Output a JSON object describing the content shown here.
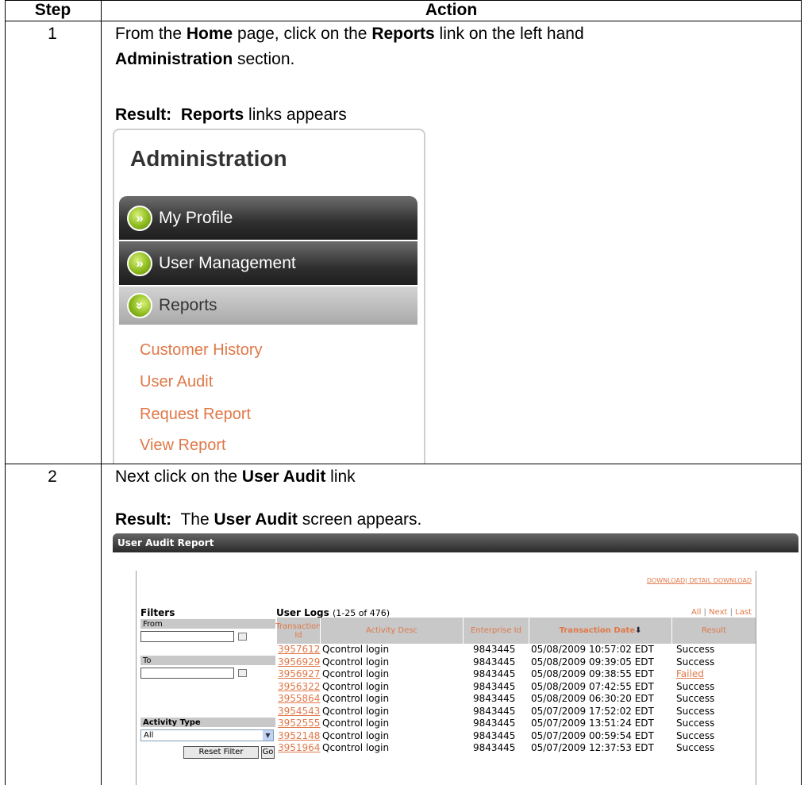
{
  "table": {
    "col_step": "Step",
    "col_action": "Action"
  },
  "steps": [
    {
      "number": "1",
      "line1_pre": "From the ",
      "line1_b1": "Home",
      "line1_mid": " page, click on the ",
      "line1_b2": "Reports",
      "line1_post": " link on the left hand",
      "line2_b": "Administration",
      "line2_post": " section.",
      "result_label": "Result:",
      "result_b": "Reports",
      "result_post": " links appears"
    },
    {
      "number": "2",
      "line1_pre": "Next click on the ",
      "line1_b": "User Audit",
      "line1_post": " link",
      "result_label": "Result:",
      "result_pre": "  The ",
      "result_b": "User Audit",
      "result_post": " screen appears."
    }
  ],
  "admin_panel": {
    "title": "Administration",
    "menu": [
      {
        "label": "My Profile",
        "icon": "double-chevron-right-icon"
      },
      {
        "label": "User Management",
        "icon": "double-chevron-right-icon"
      },
      {
        "label": "Reports",
        "icon": "double-chevron-down-icon"
      }
    ],
    "sublinks": [
      "Customer History",
      "User Audit",
      "Request Report",
      "View Report"
    ],
    "link_color": "#e07848"
  },
  "user_audit": {
    "title": "User Audit Report",
    "download": "DOWNLOAD",
    "detail_download": "DETAIL DOWNLOAD",
    "filters_title": "Filters",
    "from_label": "From",
    "to_label": "To",
    "activity_type_label": "Activity Type",
    "activity_type_value": "All",
    "reset_button": "Reset Filter",
    "go_button": "Go",
    "logs_title": "User Logs",
    "logs_range": "(1-25 of 476)",
    "nav_all": "All",
    "nav_next": "Next",
    "nav_last": "Last",
    "columns": [
      "Transaction Id",
      "Activity Desc",
      "Enterprise Id",
      "Transaction Date",
      "Result"
    ],
    "rows": [
      [
        "3957612",
        "Qcontrol login",
        "9843445",
        "05/08/2009 10:57:02 EDT",
        "Success"
      ],
      [
        "3956929",
        "Qcontrol login",
        "9843445",
        "05/08/2009 09:39:05 EDT",
        "Success"
      ],
      [
        "3956927",
        "Qcontrol login",
        "9843445",
        "05/08/2009 09:38:55 EDT",
        "Failed"
      ],
      [
        "3956322",
        "Qcontrol login",
        "9843445",
        "05/08/2009 07:42:55 EDT",
        "Success"
      ],
      [
        "3955864",
        "Qcontrol login",
        "9843445",
        "05/08/2009 06:30:20 EDT",
        "Success"
      ],
      [
        "3954543",
        "Qcontrol login",
        "9843445",
        "05/07/2009 17:52:02 EDT",
        "Success"
      ],
      [
        "3952555",
        "Qcontrol login",
        "9843445",
        "05/07/2009 13:51:24 EDT",
        "Success"
      ],
      [
        "3952148",
        "Qcontrol login",
        "9843445",
        "05/07/2009 00:59:54 EDT",
        "Success"
      ],
      [
        "3951964",
        "Qcontrol login",
        "9843445",
        "05/07/2009 12:37:53 EDT",
        "Success"
      ]
    ]
  }
}
